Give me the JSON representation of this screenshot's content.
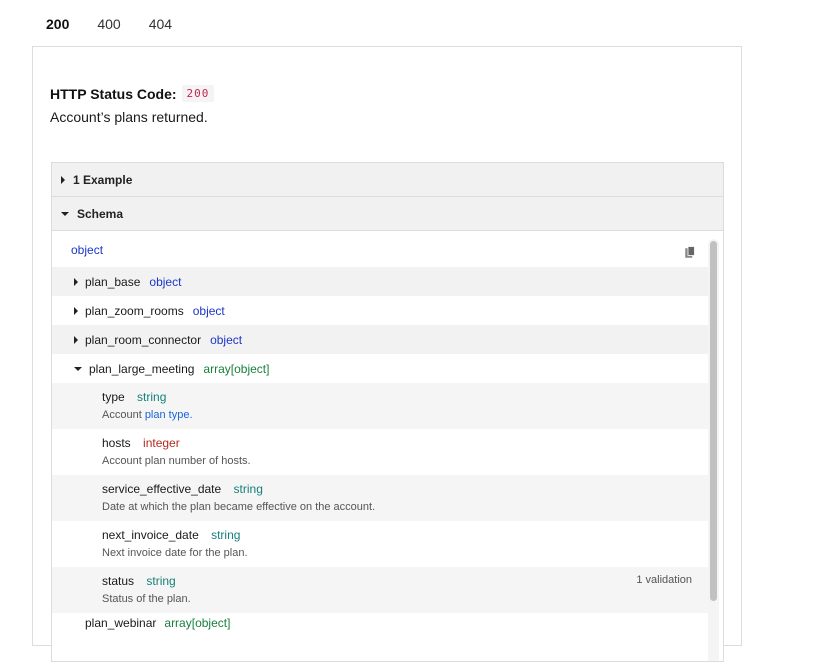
{
  "tabs": [
    {
      "label": "200",
      "active": true
    },
    {
      "label": "400",
      "active": false
    },
    {
      "label": "404",
      "active": false
    }
  ],
  "response": {
    "status_label": "HTTP Status Code:",
    "status_code": "200",
    "description": "Account’s plans returned."
  },
  "accordion": {
    "example_label": "1 Example",
    "schema_label": "Schema"
  },
  "schema": {
    "root_type": "object",
    "copy_icon": "copy-icon",
    "properties": [
      {
        "name": "plan_base",
        "type": "object",
        "expanded": false
      },
      {
        "name": "plan_zoom_rooms",
        "type": "object",
        "expanded": false
      },
      {
        "name": "plan_room_connector",
        "type": "object",
        "expanded": false
      },
      {
        "name": "plan_large_meeting",
        "type": "array[object]",
        "expanded": true
      }
    ],
    "children": [
      {
        "name": "type",
        "type": "string",
        "desc_prefix": "Account ",
        "desc_link": "plan type.",
        "desc": ""
      },
      {
        "name": "hosts",
        "type": "integer",
        "desc": "Account plan number of hosts."
      },
      {
        "name": "service_effective_date",
        "type": "string",
        "desc": "Date at which the plan became effective on the account."
      },
      {
        "name": "next_invoice_date",
        "type": "string",
        "desc": "Next invoice date for the plan."
      },
      {
        "name": "status",
        "type": "string",
        "desc": "Status of the plan.",
        "validation": "1 validation"
      }
    ],
    "next_property": {
      "name": "plan_webinar",
      "type": "array[object]"
    }
  },
  "colors": {
    "accent": "#1b64d6",
    "type_object": "#1b35c9",
    "type_array": "#19803a",
    "type_string": "#15807a",
    "type_integer": "#b22b1f",
    "status_code": "#c7254e"
  }
}
